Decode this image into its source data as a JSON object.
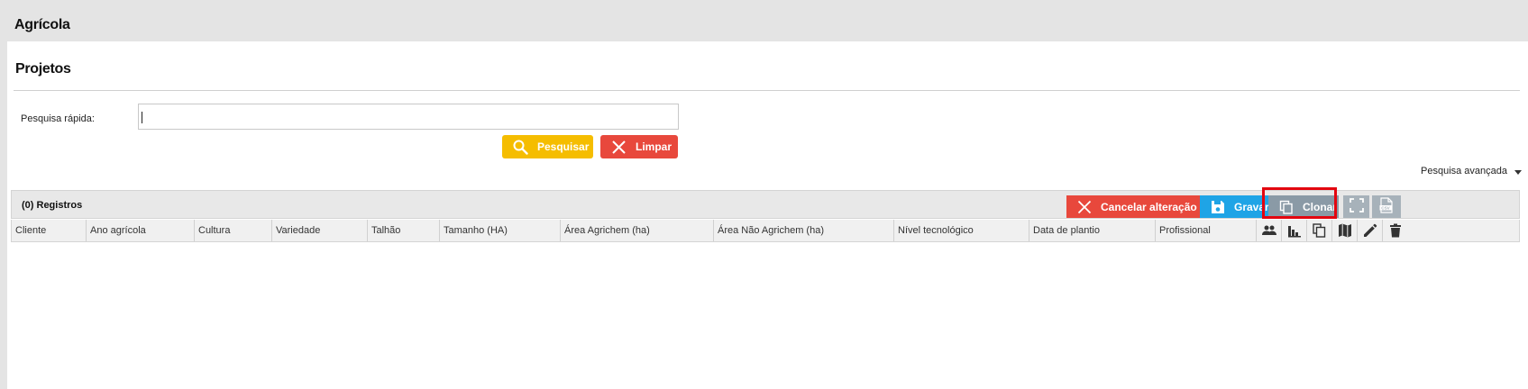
{
  "app": {
    "title": "Agrícola"
  },
  "page": {
    "title": "Projetos"
  },
  "search": {
    "label": "Pesquisa rápida:",
    "value": "",
    "search_button": "Pesquisar",
    "clear_button": "Limpar",
    "advanced_label": "Pesquisa avançada"
  },
  "grid": {
    "records_label": "(0) Registros",
    "toolbar": {
      "cancel_label": "Cancelar alteração",
      "save_label": "Gravar",
      "clone_label": "Clonar",
      "fullscreen_icon": "fullscreen-icon",
      "csv_icon": "csv-export-icon"
    },
    "columns": [
      "Cliente",
      "Ano agrícola",
      "Cultura",
      "Variedade",
      "Talhão",
      "Tamanho (HA)",
      "Área Agrichem (ha)",
      "Área Não Agrichem (ha)",
      "Nível tecnológico",
      "Data de plantio",
      "Profissional"
    ],
    "action_icons": [
      "people-icon",
      "bar-chart-icon",
      "copy-icon",
      "map-icon",
      "edit-icon",
      "delete-icon"
    ],
    "rows": []
  },
  "colors": {
    "warning": "#f5bd00",
    "danger": "#e8483c",
    "primary": "#1fa4e6",
    "muted": "#8a9aa6",
    "highlight": "#e3050f"
  }
}
